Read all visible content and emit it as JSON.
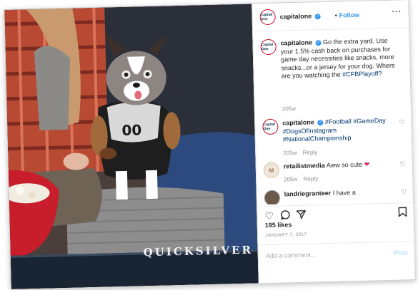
{
  "watermark": "QUICKSILVER",
  "post": {
    "username": "capitalone",
    "verified_glyph": "✓",
    "separator": "•",
    "follow_label": "Follow",
    "more_icon": "more-options-icon",
    "more_label": "···",
    "avatar_text": "Capital One"
  },
  "caption": {
    "username": "capitalone",
    "text": "Go the extra yard. Use your 1.5% cash back on purchases for game day necessities like snacks, more snacks...or a jersey for your dog. Where are you watching the",
    "hashtag": "#CFBPlayoff?",
    "time": "205w"
  },
  "comments": [
    {
      "username": "capitalone",
      "text": "",
      "hashtags": "#Football #GameDay #DogsOfInstagram #NationalChampionship",
      "time": "205w",
      "reply": "Reply"
    },
    {
      "username": "retailistmedia",
      "text": "Aww so cute",
      "emoji": "❤",
      "time": "205w",
      "reply": "Reply"
    },
    {
      "username": "landriegranteer",
      "text": "I have a"
    }
  ],
  "actions": {
    "like_icon": "heart-icon",
    "comment_icon": "comment-icon",
    "share_icon": "share-icon",
    "save_icon": "bookmark-icon"
  },
  "likes": "195 likes",
  "date": "JANUARY 7, 2017",
  "add_comment": {
    "placeholder": "Add a comment...",
    "post_label": "Post"
  },
  "colors": {
    "accent": "#3897f0",
    "tag": "#00376b",
    "brand_red": "#c8102e",
    "muted": "#8e8e8e"
  }
}
